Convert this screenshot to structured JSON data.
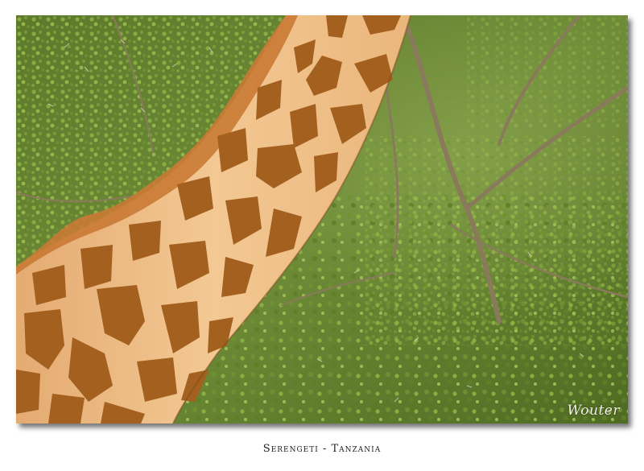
{
  "photo": {
    "subject": "giraffe neck in front of acacia foliage",
    "colors": {
      "foliage_dark": "#4f6b22",
      "foliage_light": "#8fb244",
      "background_green": "#6f8d3a",
      "giraffe_base": "#f0c089",
      "giraffe_spot": "#a4601f",
      "mane": "#c97a34"
    },
    "signature": "Wouter"
  },
  "caption": {
    "text": "Serengeti - Tanzania"
  }
}
